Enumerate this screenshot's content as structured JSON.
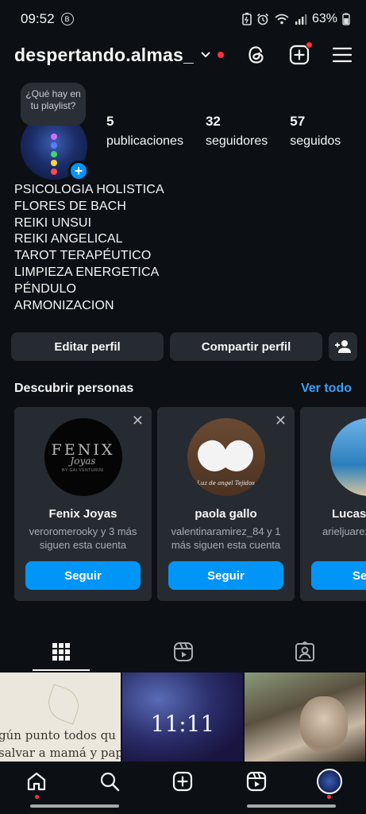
{
  "status_bar": {
    "time": "09:52",
    "battery": "63%",
    "left_badge": "B"
  },
  "header": {
    "username": "despertando.almas_"
  },
  "profile": {
    "note": "¿Qué hay en tu playlist?",
    "stats": [
      {
        "num": "5",
        "label": "publicaciones"
      },
      {
        "num": "32",
        "label": "seguidores"
      },
      {
        "num": "57",
        "label": "seguidos"
      }
    ],
    "bio_lines": [
      "PSICOLOGIA HOLISTICA",
      "FLORES DE BACH",
      "REIKI UNSUI",
      "REIKI ANGELICAL",
      "TAROT TERAPÉUTICO",
      "LIMPIEZA ENERGETICA",
      "PÉNDULO",
      "ARMONIZACION"
    ]
  },
  "buttons": {
    "edit": "Editar perfil",
    "share": "Compartir perfil"
  },
  "discover": {
    "title": "Descubrir personas",
    "see_all": "Ver todo",
    "cards": [
      {
        "name": "Fenix Joyas",
        "sub": "veroromerooky y 3 más siguen esta cuenta",
        "follow": "Seguir",
        "pic_word": "FENIX",
        "pic_script": "Joyas",
        "pic_by": "BY GAI VENTURINI"
      },
      {
        "name": "paola gallo",
        "sub": "valentinaramirez_84 y 1 más siguen esta cuenta",
        "follow": "Seguir",
        "pic_text": "Luz de angel Tejidos"
      },
      {
        "name": "Lucas",
        "sub": "arieljuarez y siguen es",
        "follow": "Se"
      }
    ]
  },
  "grid": {
    "post1_line1": "gún punto todos qu",
    "post1_line2": "salvar a mamá y pap",
    "post2_time": "11:11"
  },
  "colors": {
    "background": "#0c1014",
    "button_bg": "#262b31",
    "accent_blue": "#0095f6",
    "link_blue": "#3d9df3",
    "notification_red": "#ff3040"
  }
}
